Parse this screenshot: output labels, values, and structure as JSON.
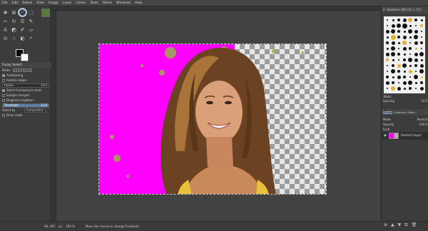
{
  "menubar": [
    "File",
    "Edit",
    "Select",
    "View",
    "Image",
    "Layer",
    "Colors",
    "Tools",
    "Filters",
    "Windows",
    "Help"
  ],
  "tool_options": {
    "title": "Fuzzy Select",
    "mode_label": "Mode:",
    "antialiasing": "Antialiasing",
    "feather_edges": "Feather edges",
    "radius_label": "Radius",
    "radius_value": "10.0",
    "select_transparent": "Select transparent areas",
    "sample_merged": "Sample merged",
    "diagonal_neighbors": "Diagonal neighbors",
    "threshold_label": "Threshold",
    "threshold_value": "15.0",
    "select_by_label": "Select by",
    "select_by_value": "Composite",
    "draw_mask": "Draw mask"
  },
  "dock": {
    "brushes_header": "2. Hardness 050 (51 × 51)",
    "brush_filter": "Basic,",
    "spacing_label": "Spacing",
    "spacing_value": "10.0",
    "tabs": [
      "Layers",
      "Channels",
      "Paths"
    ],
    "mode_label": "Mode",
    "mode_value": "Normal",
    "opacity_label": "Opacity",
    "opacity_value": "100.0",
    "lock_label": "Lock:",
    "layer_name": "Pasted Layer"
  },
  "statusbar": {
    "coords": "98, 287",
    "unit": "px",
    "zoom": "100 %",
    "message": "Move the mouse to change threshold"
  },
  "colors": {
    "foreground": "#000000",
    "background": "#ffffff",
    "magenta": "#ff00ff",
    "selection_accent": "#8ab4e8"
  }
}
